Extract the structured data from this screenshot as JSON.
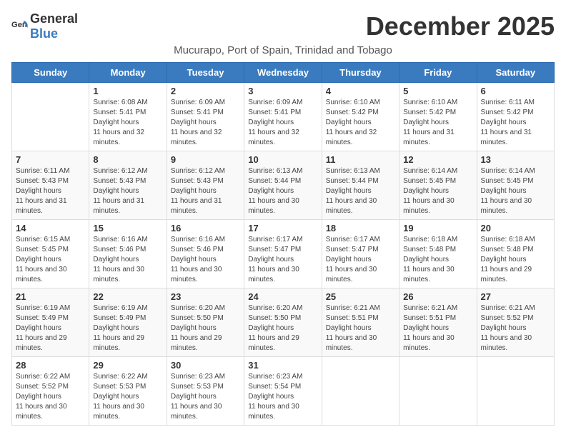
{
  "header": {
    "logo_general": "General",
    "logo_blue": "Blue",
    "month_title": "December 2025",
    "subtitle": "Mucurapo, Port of Spain, Trinidad and Tobago"
  },
  "days_of_week": [
    "Sunday",
    "Monday",
    "Tuesday",
    "Wednesday",
    "Thursday",
    "Friday",
    "Saturday"
  ],
  "weeks": [
    [
      {
        "day": "",
        "sunrise": "",
        "sunset": "",
        "daylight": ""
      },
      {
        "day": "1",
        "sunrise": "6:08 AM",
        "sunset": "5:41 PM",
        "daylight": "11 hours and 32 minutes."
      },
      {
        "day": "2",
        "sunrise": "6:09 AM",
        "sunset": "5:41 PM",
        "daylight": "11 hours and 32 minutes."
      },
      {
        "day": "3",
        "sunrise": "6:09 AM",
        "sunset": "5:41 PM",
        "daylight": "11 hours and 32 minutes."
      },
      {
        "day": "4",
        "sunrise": "6:10 AM",
        "sunset": "5:42 PM",
        "daylight": "11 hours and 32 minutes."
      },
      {
        "day": "5",
        "sunrise": "6:10 AM",
        "sunset": "5:42 PM",
        "daylight": "11 hours and 31 minutes."
      },
      {
        "day": "6",
        "sunrise": "6:11 AM",
        "sunset": "5:42 PM",
        "daylight": "11 hours and 31 minutes."
      }
    ],
    [
      {
        "day": "7",
        "sunrise": "6:11 AM",
        "sunset": "5:43 PM",
        "daylight": "11 hours and 31 minutes."
      },
      {
        "day": "8",
        "sunrise": "6:12 AM",
        "sunset": "5:43 PM",
        "daylight": "11 hours and 31 minutes."
      },
      {
        "day": "9",
        "sunrise": "6:12 AM",
        "sunset": "5:43 PM",
        "daylight": "11 hours and 31 minutes."
      },
      {
        "day": "10",
        "sunrise": "6:13 AM",
        "sunset": "5:44 PM",
        "daylight": "11 hours and 30 minutes."
      },
      {
        "day": "11",
        "sunrise": "6:13 AM",
        "sunset": "5:44 PM",
        "daylight": "11 hours and 30 minutes."
      },
      {
        "day": "12",
        "sunrise": "6:14 AM",
        "sunset": "5:45 PM",
        "daylight": "11 hours and 30 minutes."
      },
      {
        "day": "13",
        "sunrise": "6:14 AM",
        "sunset": "5:45 PM",
        "daylight": "11 hours and 30 minutes."
      }
    ],
    [
      {
        "day": "14",
        "sunrise": "6:15 AM",
        "sunset": "5:45 PM",
        "daylight": "11 hours and 30 minutes."
      },
      {
        "day": "15",
        "sunrise": "6:16 AM",
        "sunset": "5:46 PM",
        "daylight": "11 hours and 30 minutes."
      },
      {
        "day": "16",
        "sunrise": "6:16 AM",
        "sunset": "5:46 PM",
        "daylight": "11 hours and 30 minutes."
      },
      {
        "day": "17",
        "sunrise": "6:17 AM",
        "sunset": "5:47 PM",
        "daylight": "11 hours and 30 minutes."
      },
      {
        "day": "18",
        "sunrise": "6:17 AM",
        "sunset": "5:47 PM",
        "daylight": "11 hours and 30 minutes."
      },
      {
        "day": "19",
        "sunrise": "6:18 AM",
        "sunset": "5:48 PM",
        "daylight": "11 hours and 30 minutes."
      },
      {
        "day": "20",
        "sunrise": "6:18 AM",
        "sunset": "5:48 PM",
        "daylight": "11 hours and 29 minutes."
      }
    ],
    [
      {
        "day": "21",
        "sunrise": "6:19 AM",
        "sunset": "5:49 PM",
        "daylight": "11 hours and 29 minutes."
      },
      {
        "day": "22",
        "sunrise": "6:19 AM",
        "sunset": "5:49 PM",
        "daylight": "11 hours and 29 minutes."
      },
      {
        "day": "23",
        "sunrise": "6:20 AM",
        "sunset": "5:50 PM",
        "daylight": "11 hours and 29 minutes."
      },
      {
        "day": "24",
        "sunrise": "6:20 AM",
        "sunset": "5:50 PM",
        "daylight": "11 hours and 29 minutes."
      },
      {
        "day": "25",
        "sunrise": "6:21 AM",
        "sunset": "5:51 PM",
        "daylight": "11 hours and 30 minutes."
      },
      {
        "day": "26",
        "sunrise": "6:21 AM",
        "sunset": "5:51 PM",
        "daylight": "11 hours and 30 minutes."
      },
      {
        "day": "27",
        "sunrise": "6:21 AM",
        "sunset": "5:52 PM",
        "daylight": "11 hours and 30 minutes."
      }
    ],
    [
      {
        "day": "28",
        "sunrise": "6:22 AM",
        "sunset": "5:52 PM",
        "daylight": "11 hours and 30 minutes."
      },
      {
        "day": "29",
        "sunrise": "6:22 AM",
        "sunset": "5:53 PM",
        "daylight": "11 hours and 30 minutes."
      },
      {
        "day": "30",
        "sunrise": "6:23 AM",
        "sunset": "5:53 PM",
        "daylight": "11 hours and 30 minutes."
      },
      {
        "day": "31",
        "sunrise": "6:23 AM",
        "sunset": "5:54 PM",
        "daylight": "11 hours and 30 minutes."
      },
      {
        "day": "",
        "sunrise": "",
        "sunset": "",
        "daylight": ""
      },
      {
        "day": "",
        "sunrise": "",
        "sunset": "",
        "daylight": ""
      },
      {
        "day": "",
        "sunrise": "",
        "sunset": "",
        "daylight": ""
      }
    ]
  ],
  "labels": {
    "sunrise_prefix": "Sunrise: ",
    "sunset_prefix": "Sunset: ",
    "daylight_prefix": "Daylight: "
  }
}
